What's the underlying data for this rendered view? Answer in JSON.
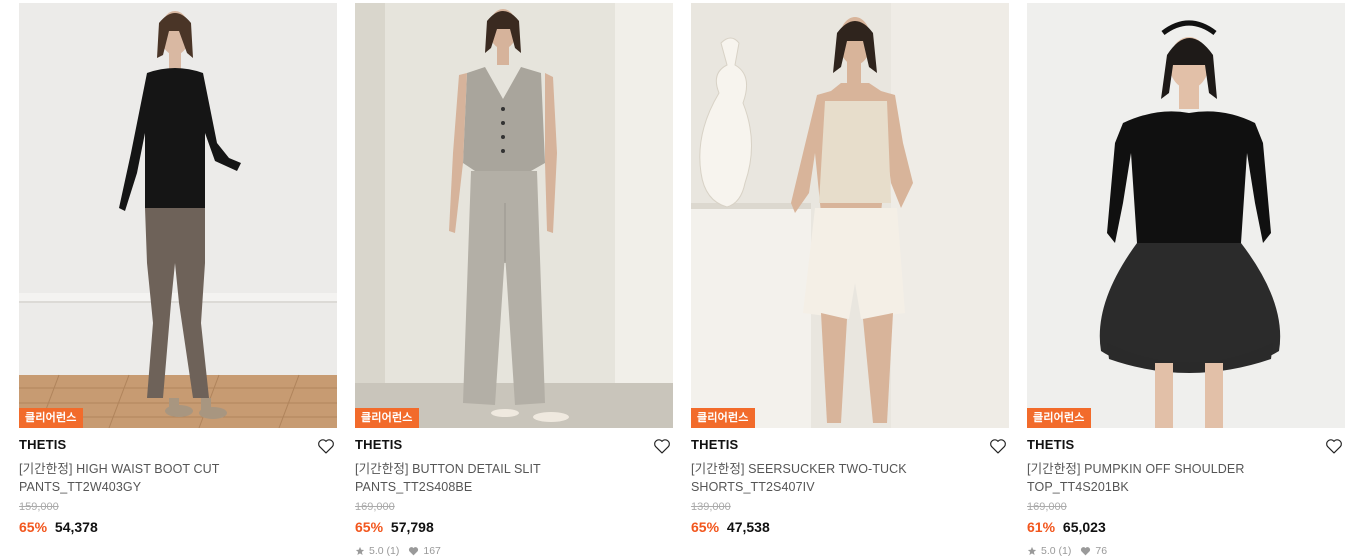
{
  "products": [
    {
      "badge": "클리어런스",
      "brand": "THETIS",
      "name": "[기간한정] HIGH WAIST BOOT CUT PANTS_TT2W403GY",
      "original_price": "159,000",
      "discount": "65%",
      "sale_price": "54,378",
      "rating": "",
      "review_count": "",
      "likes": ""
    },
    {
      "badge": "클리어런스",
      "brand": "THETIS",
      "name": "[기간한정] BUTTON DETAIL SLIT PANTS_TT2S408BE",
      "original_price": "169,000",
      "discount": "65%",
      "sale_price": "57,798",
      "rating": "5.0",
      "review_count": "(1)",
      "likes": "167"
    },
    {
      "badge": "클리어런스",
      "brand": "THETIS",
      "name": "[기간한정] SEERSUCKER TWO-TUCK SHORTS_TT2S407IV",
      "original_price": "139,000",
      "discount": "65%",
      "sale_price": "47,538",
      "rating": "",
      "review_count": "",
      "likes": ""
    },
    {
      "badge": "클리어런스",
      "brand": "THETIS",
      "name": "[기간한정] PUMPKIN OFF SHOULDER TOP_TT4S201BK",
      "original_price": "169,000",
      "discount": "61%",
      "sale_price": "65,023",
      "rating": "5.0",
      "review_count": "(1)",
      "likes": "76"
    }
  ],
  "colors": {
    "badge": "#f26b2b",
    "discount": "#f2561d",
    "brand_text": "#111111",
    "muted_text": "#999999"
  },
  "icons": {
    "wishlist": "heart-outline-icon",
    "rating": "star-icon",
    "likes": "heart-filled-icon"
  }
}
